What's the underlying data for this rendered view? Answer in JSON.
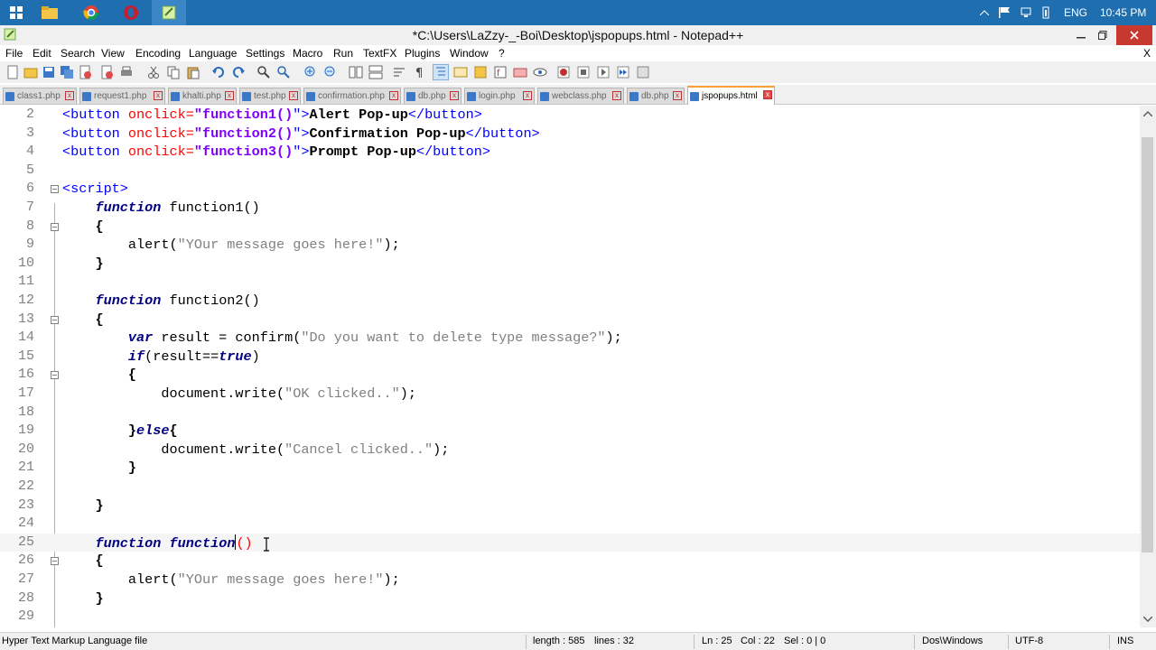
{
  "taskbar": {
    "tray": {
      "language": "ENG",
      "time": "10:45 PM"
    }
  },
  "window": {
    "title": "*C:\\Users\\LaZzy-_-Boi\\Desktop\\jspopups.html - Notepad++",
    "menu_close": "X"
  },
  "menu": [
    "File",
    "Edit",
    "Search",
    "View",
    "Encoding",
    "Language",
    "Settings",
    "Macro",
    "Run",
    "TextFX",
    "Plugins",
    "Window",
    "?"
  ],
  "tabs": [
    {
      "label": "class1.php",
      "active": false
    },
    {
      "label": "request1.php",
      "active": false
    },
    {
      "label": "khalti.php",
      "active": false
    },
    {
      "label": "test.php",
      "active": false
    },
    {
      "label": "confirmation.php",
      "active": false
    },
    {
      "label": "db.php",
      "active": false
    },
    {
      "label": "login.php",
      "active": false
    },
    {
      "label": "webclass.php",
      "active": false
    },
    {
      "label": "db.php",
      "active": false
    },
    {
      "label": "jspopups.html",
      "active": true
    }
  ],
  "editor": {
    "line_numbers": [
      "2",
      "3",
      "4",
      "5",
      "6",
      "7",
      "8",
      "9",
      "10",
      "11",
      "12",
      "13",
      "14",
      "15",
      "16",
      "17",
      "18",
      "19",
      "20",
      "21",
      "22",
      "23",
      "24",
      "25",
      "26",
      "27",
      "28",
      "29"
    ],
    "lines": {
      "l2": {
        "a": "<button",
        "b": " onclick=",
        "c": "\"",
        "d": "function1()",
        "e": "\">",
        "f": "Alert Pop-up",
        "g": "</button>"
      },
      "l3": {
        "a": "<button",
        "b": " onclick=",
        "c": "\"",
        "d": "function2()",
        "e": "\">",
        "f": "Confirmation Pop-up",
        "g": "</button>"
      },
      "l4": {
        "a": "<button",
        "b": " onclick=",
        "c": "\"",
        "d": "function3()",
        "e": "\">",
        "f": "Prompt Pop-up",
        "g": "</button>"
      },
      "l6": "<script>",
      "l7": {
        "kw": "function",
        "rest": " function1()"
      },
      "l8": "{",
      "l9": {
        "a": "alert(",
        "s": "\"YOur message goes here!\"",
        "b": ");"
      },
      "l10": "}",
      "l12": {
        "kw": "function",
        "rest": " function2()"
      },
      "l13": "{",
      "l14": {
        "kw": "var",
        "a": " result = confirm(",
        "s": "\"Do you want to delete type message?\"",
        "b": ");"
      },
      "l15": {
        "kw": "if",
        "a": "(result==",
        "kw2": "true",
        "b": ")"
      },
      "l16": "{",
      "l17": {
        "a": "document.write(",
        "s": "\"OK clicked..\"",
        "b": ");"
      },
      "l19": {
        "a": "}",
        "kw": "else",
        "b": "{"
      },
      "l20": {
        "a": "document.write(",
        "s": "\"Cancel clicked..\"",
        "b": ");"
      },
      "l21": "}",
      "l23": "}",
      "l25": {
        "kw": "function",
        "kw2": "function",
        "rest": "()"
      },
      "l26": "{",
      "l27": {
        "a": "alert(",
        "s": "\"YOur message goes here!\"",
        "b": ");"
      },
      "l28": "}"
    }
  },
  "status": {
    "file_type": "Hyper Text Markup Language file",
    "length": "length : 585",
    "lines": "lines : 32",
    "ln": "Ln : 25",
    "col": "Col : 22",
    "sel": "Sel : 0 | 0",
    "eol": "Dos\\Windows",
    "encoding": "UTF-8",
    "mode": "INS"
  }
}
